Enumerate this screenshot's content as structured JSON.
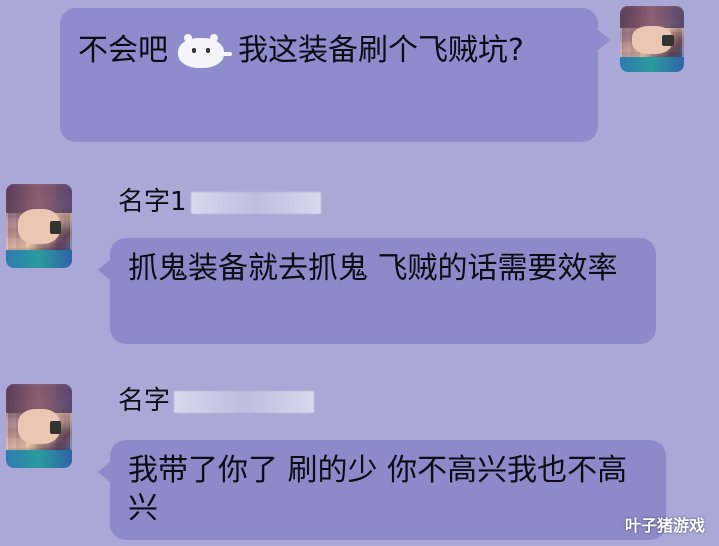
{
  "messages": [
    {
      "side": "right",
      "text_before_sticker": "不会吧",
      "sticker": "cat-sticker",
      "text_after_sticker": "我这装备刷个飞贼坑?"
    },
    {
      "side": "left",
      "sender_name": "名字1",
      "text": "抓鬼装备就去抓鬼 飞贼的话需要效率"
    },
    {
      "side": "left",
      "sender_name": "名字",
      "text": "我带了你了 刷的少 你不高兴我也不高兴"
    }
  ],
  "watermark": "叶子猪游戏",
  "colors": {
    "background": "#a9a8d6",
    "bubble": "#8c8ac9"
  }
}
